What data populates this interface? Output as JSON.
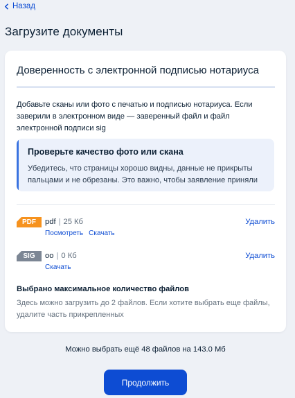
{
  "nav": {
    "back_label": "Назад"
  },
  "page": {
    "title": "Загрузите документы"
  },
  "card": {
    "title": "Доверенность с электронной подписью нотариуса",
    "description": "Добавьте сканы или фото с печатью и подписью нотариуса. Если заверили в электронном виде — заверенный файл и файл электронной подписи sig",
    "notice": {
      "title": "Проверьте качество фото или скана",
      "text": "Убедитесь, что страницы хорошо видны, данные не прикрыты пальцами и не обрезаны. Это важно, чтобы заявление приняли",
      "accent_color": "#3a73e0"
    },
    "files": [
      {
        "badge": "PDF",
        "badge_color": "#f6921e",
        "name": "pdf",
        "size": "25 Кб",
        "view_label": "Посмотреть",
        "download_label": "Скачать",
        "delete_label": "Удалить"
      },
      {
        "badge": "SIG",
        "badge_color": "#7c8694",
        "name": "oo",
        "size": "0 Кб",
        "download_label": "Скачать",
        "delete_label": "Удалить"
      }
    ],
    "limit": {
      "title": "Выбрано максимальное количество файлов",
      "text": "Здесь можно загрузить до 2 файлов. Если хотите выбрать еще файлы, удалите часть прикрепленных"
    }
  },
  "remaining_text": "Можно выбрать ещё 48 файлов на 143.0 Мб",
  "continue_label": "Продолжить",
  "colors": {
    "primary": "#0d4cd3",
    "background": "#eef1f6"
  }
}
